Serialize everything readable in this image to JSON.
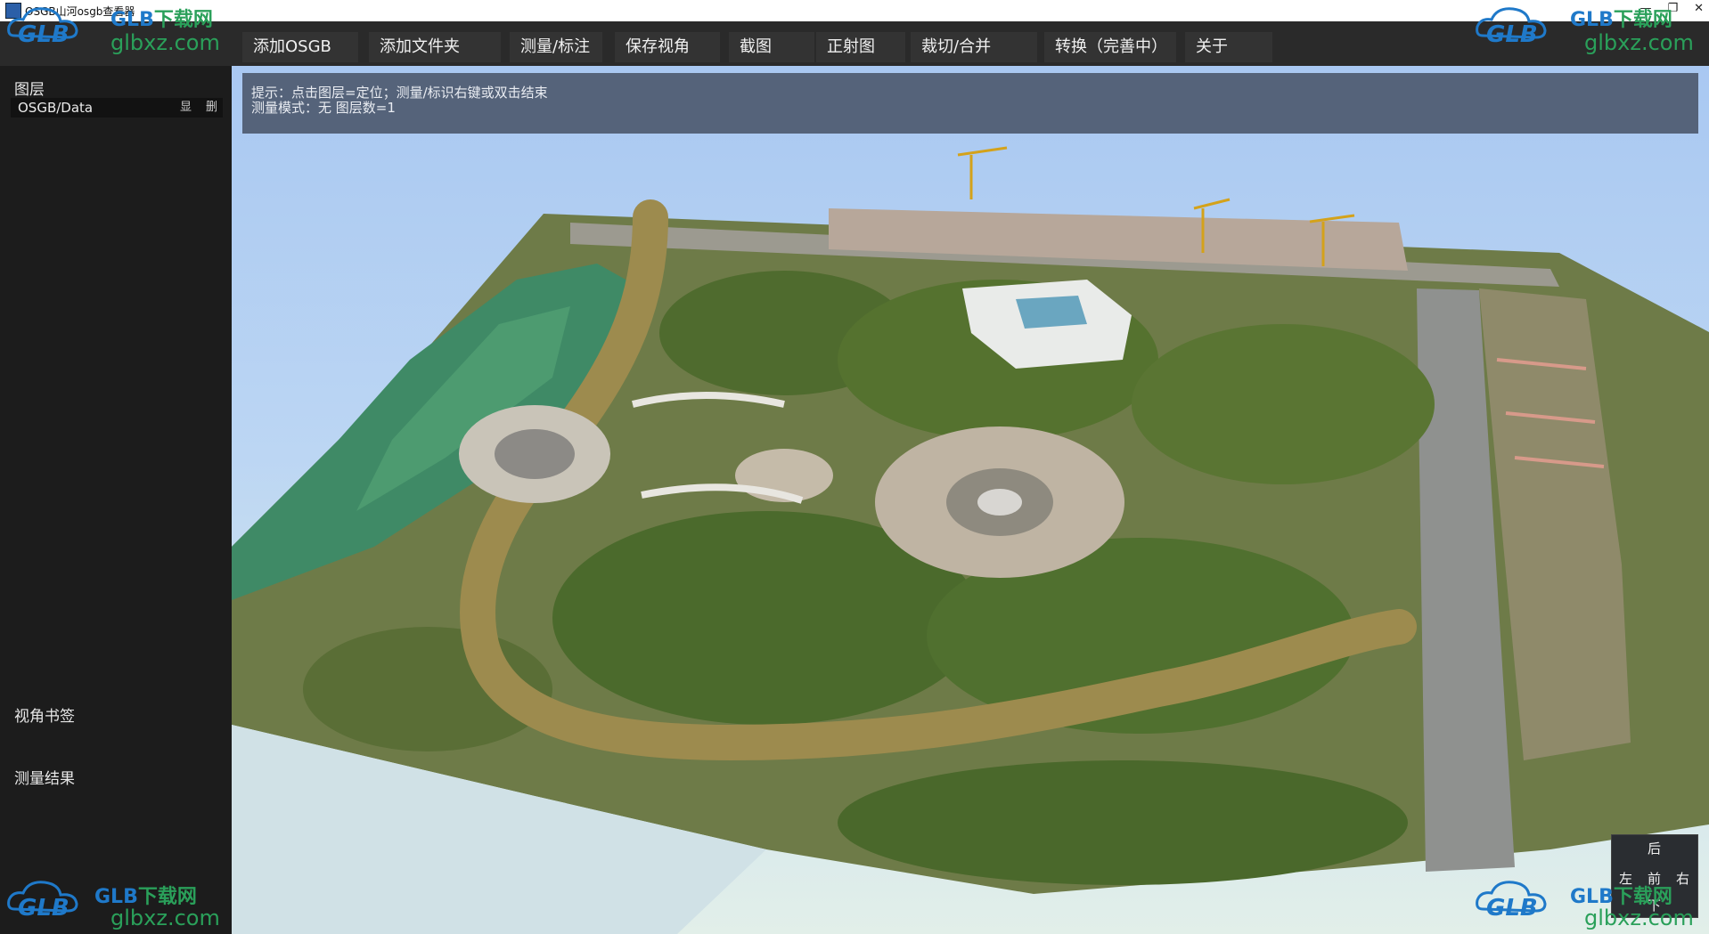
{
  "window": {
    "title": "OSGB山河osgb查看器"
  },
  "menu": [
    "添加OSGB",
    "添加文件夹",
    "测量/标注",
    "保存视角",
    "截图",
    "正射图",
    "裁切/合并",
    "转换（完善中）",
    "关于"
  ],
  "sidebar": {
    "layers_title": "图层",
    "layers": [
      {
        "name": "OSGB/Data",
        "show_label": "显",
        "delete_label": "删"
      }
    ],
    "bookmarks_title": "视角书签",
    "results_title": "测量结果"
  },
  "info": {
    "line1": "提示：点击图层=定位；测量/标识右键或双击结束",
    "line2": "测量模式：无  图层数=1"
  },
  "nav": {
    "up": "后",
    "left": "左",
    "center": "前",
    "right": "右",
    "down": "下"
  },
  "watermark": {
    "glb": "GLB",
    "brand_prefix": "GLB",
    "brand_suffix": "下载网",
    "url": "glbxz.com"
  },
  "colors": {
    "accent": "#55637a",
    "menu_bg": "#333333",
    "sidebar_bg": "#1c1c1c"
  }
}
